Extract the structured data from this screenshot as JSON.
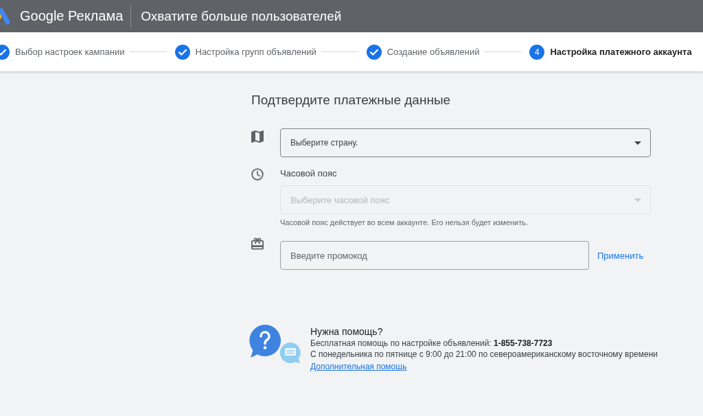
{
  "header": {
    "brand": "Google Реклама",
    "title": "Охватите больше пользователей"
  },
  "steps": [
    {
      "label": "Выбор настроек кампании",
      "completed": true,
      "selected": false
    },
    {
      "label": "Настройка групп объявлений",
      "completed": true,
      "selected": false
    },
    {
      "label": "Создание объявлений",
      "completed": true,
      "selected": false
    },
    {
      "label": "Настройка платежного аккаунта",
      "completed": false,
      "selected": true,
      "number": "4"
    }
  ],
  "form": {
    "title": "Подтвердите платежные данные",
    "country": {
      "placeholder": "Выберите страну.",
      "disabled": false
    },
    "timezone": {
      "label": "Часовой пояс",
      "placeholder": "Выберите часовой пояс",
      "disabled": true,
      "hint": "Часовой пояс действует во всем аккаунте. Его нельзя будет изменить."
    },
    "promo": {
      "placeholder": "Введите промокод",
      "apply": "Применить"
    }
  },
  "help": {
    "title": "Нужна помощь?",
    "phone_line": "Бесплатная помощь по настройке объявлений: **1-855-738-7723**",
    "hours": "С понедельника по пятнице с 9:00 до 21:00 по североамериканскому восточному времени",
    "link": "Дополнительная помощь"
  }
}
